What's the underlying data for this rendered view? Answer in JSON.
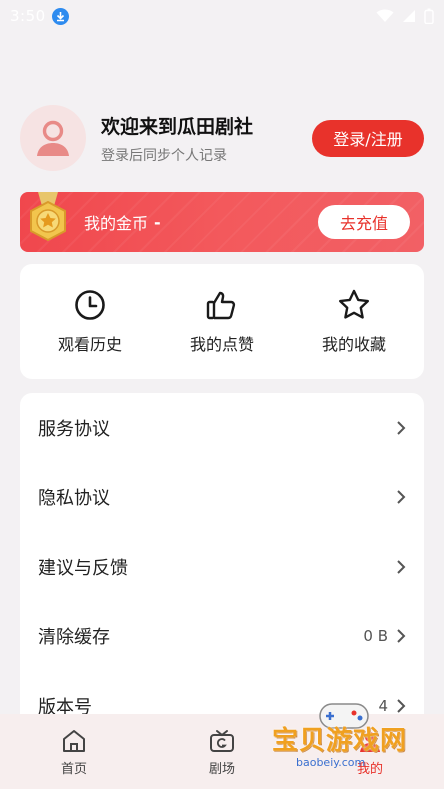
{
  "status_bar": {
    "time": "3:50"
  },
  "profile": {
    "welcome": "欢迎来到瓜田剧社",
    "subtitle": "登录后同步个人记录",
    "login_button": "登录/注册"
  },
  "coins": {
    "label": "我的金币",
    "value": "-",
    "recharge_button": "去充值"
  },
  "quick_actions": [
    {
      "label": "观看历史",
      "icon": "clock-icon"
    },
    {
      "label": "我的点赞",
      "icon": "thumbs-up-icon"
    },
    {
      "label": "我的收藏",
      "icon": "star-icon"
    }
  ],
  "menu": [
    {
      "label": "服务协议",
      "value": ""
    },
    {
      "label": "隐私协议",
      "value": ""
    },
    {
      "label": "建议与反馈",
      "value": ""
    },
    {
      "label": "清除缓存",
      "value": "0 B"
    },
    {
      "label": "版本号",
      "value": "4"
    }
  ],
  "bottom_nav": [
    {
      "label": "首页",
      "icon": "home-icon"
    },
    {
      "label": "剧场",
      "icon": "tv-icon"
    },
    {
      "label": "我的",
      "icon": "user-icon"
    }
  ],
  "watermark": {
    "text": "宝贝游戏网",
    "url": "baobeiy.com"
  },
  "colors": {
    "accent": "#e8322b",
    "banner": "#f0474d",
    "background": "#f3f1f3"
  }
}
